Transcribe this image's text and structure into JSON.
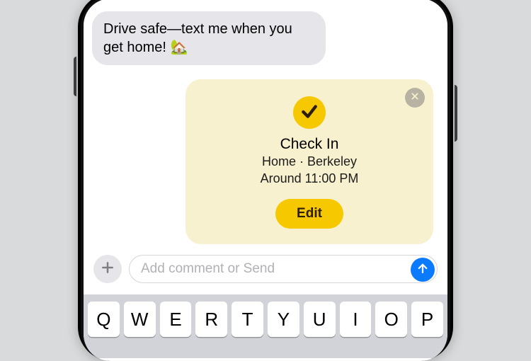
{
  "message": {
    "text": "Drive safe—text me when you get home! 🏡"
  },
  "checkin": {
    "title": "Check In",
    "location": "Home · Berkeley",
    "eta": "Around 11:00 PM",
    "edit_label": "Edit"
  },
  "composer": {
    "placeholder": "Add comment or Send"
  },
  "keyboard": {
    "row1": [
      "Q",
      "W",
      "E",
      "R",
      "T",
      "Y",
      "U",
      "I",
      "O",
      "P"
    ]
  },
  "colors": {
    "accent": "#f6c800",
    "ios_blue": "#0a7aff",
    "card_bg": "#f8f1cf",
    "bubble_gray": "#e5e5ea"
  }
}
